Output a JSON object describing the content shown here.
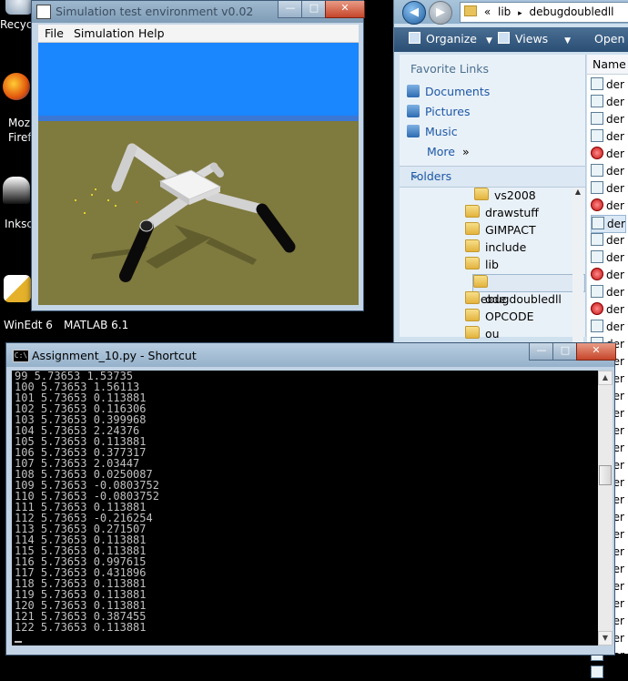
{
  "desktop": {
    "icons": [
      {
        "label": "Recycl"
      },
      {
        "label": "Moz"
      },
      {
        "label": "Firef"
      },
      {
        "label": "Inksc"
      },
      {
        "label": "WinEdt 6"
      },
      {
        "label": "MATLAB 6.1"
      }
    ]
  },
  "explorer": {
    "address": {
      "sep": "«",
      "crumb1": "lib",
      "arrow": "▸",
      "crumb2": "debugdoubledll"
    },
    "toolbar": {
      "organize": "Organize",
      "views": "Views",
      "open": "Open"
    },
    "favorite_links_title": "Favorite Links",
    "favorites": [
      "Documents",
      "Pictures",
      "Music"
    ],
    "more": "More",
    "folders_label": "Folders",
    "tree": [
      "vs2008",
      "drawstuff",
      "GIMPACT",
      "include",
      "lib",
      "debugdoubledll",
      "ode",
      "OPCODE",
      "ou"
    ],
    "column_name": "Name",
    "file_prefix": "der"
  },
  "simulation": {
    "title": "Simulation test environment v0.02",
    "menu": [
      "File",
      "Simulation",
      "Help"
    ],
    "colors": {
      "sky": "#1a86ff",
      "horizon": "#3b78d4",
      "ground": "#7f7a3e"
    }
  },
  "console": {
    "title": "Assignment_10.py - Shortcut",
    "icon_text": "C:\\",
    "lines": [
      "99 5.73653 1.53735",
      "100 5.73653 1.56113",
      "101 5.73653 0.113881",
      "102 5.73653 0.116306",
      "103 5.73653 0.399968",
      "104 5.73653 2.24376",
      "105 5.73653 0.113881",
      "106 5.73653 0.377317",
      "107 5.73653 2.03447",
      "108 5.73653 0.0250087",
      "109 5.73653 -0.0803752",
      "110 5.73653 -0.0803752",
      "111 5.73653 0.113881",
      "112 5.73653 -0.216254",
      "113 5.73653 0.271507",
      "114 5.73653 0.113881",
      "115 5.73653 0.113881",
      "116 5.73653 0.997615",
      "117 5.73653 0.431896",
      "118 5.73653 0.113881",
      "119 5.73653 0.113881",
      "120 5.73653 0.113881",
      "121 5.73653 0.387455",
      "122 5.73653 0.113881"
    ]
  }
}
